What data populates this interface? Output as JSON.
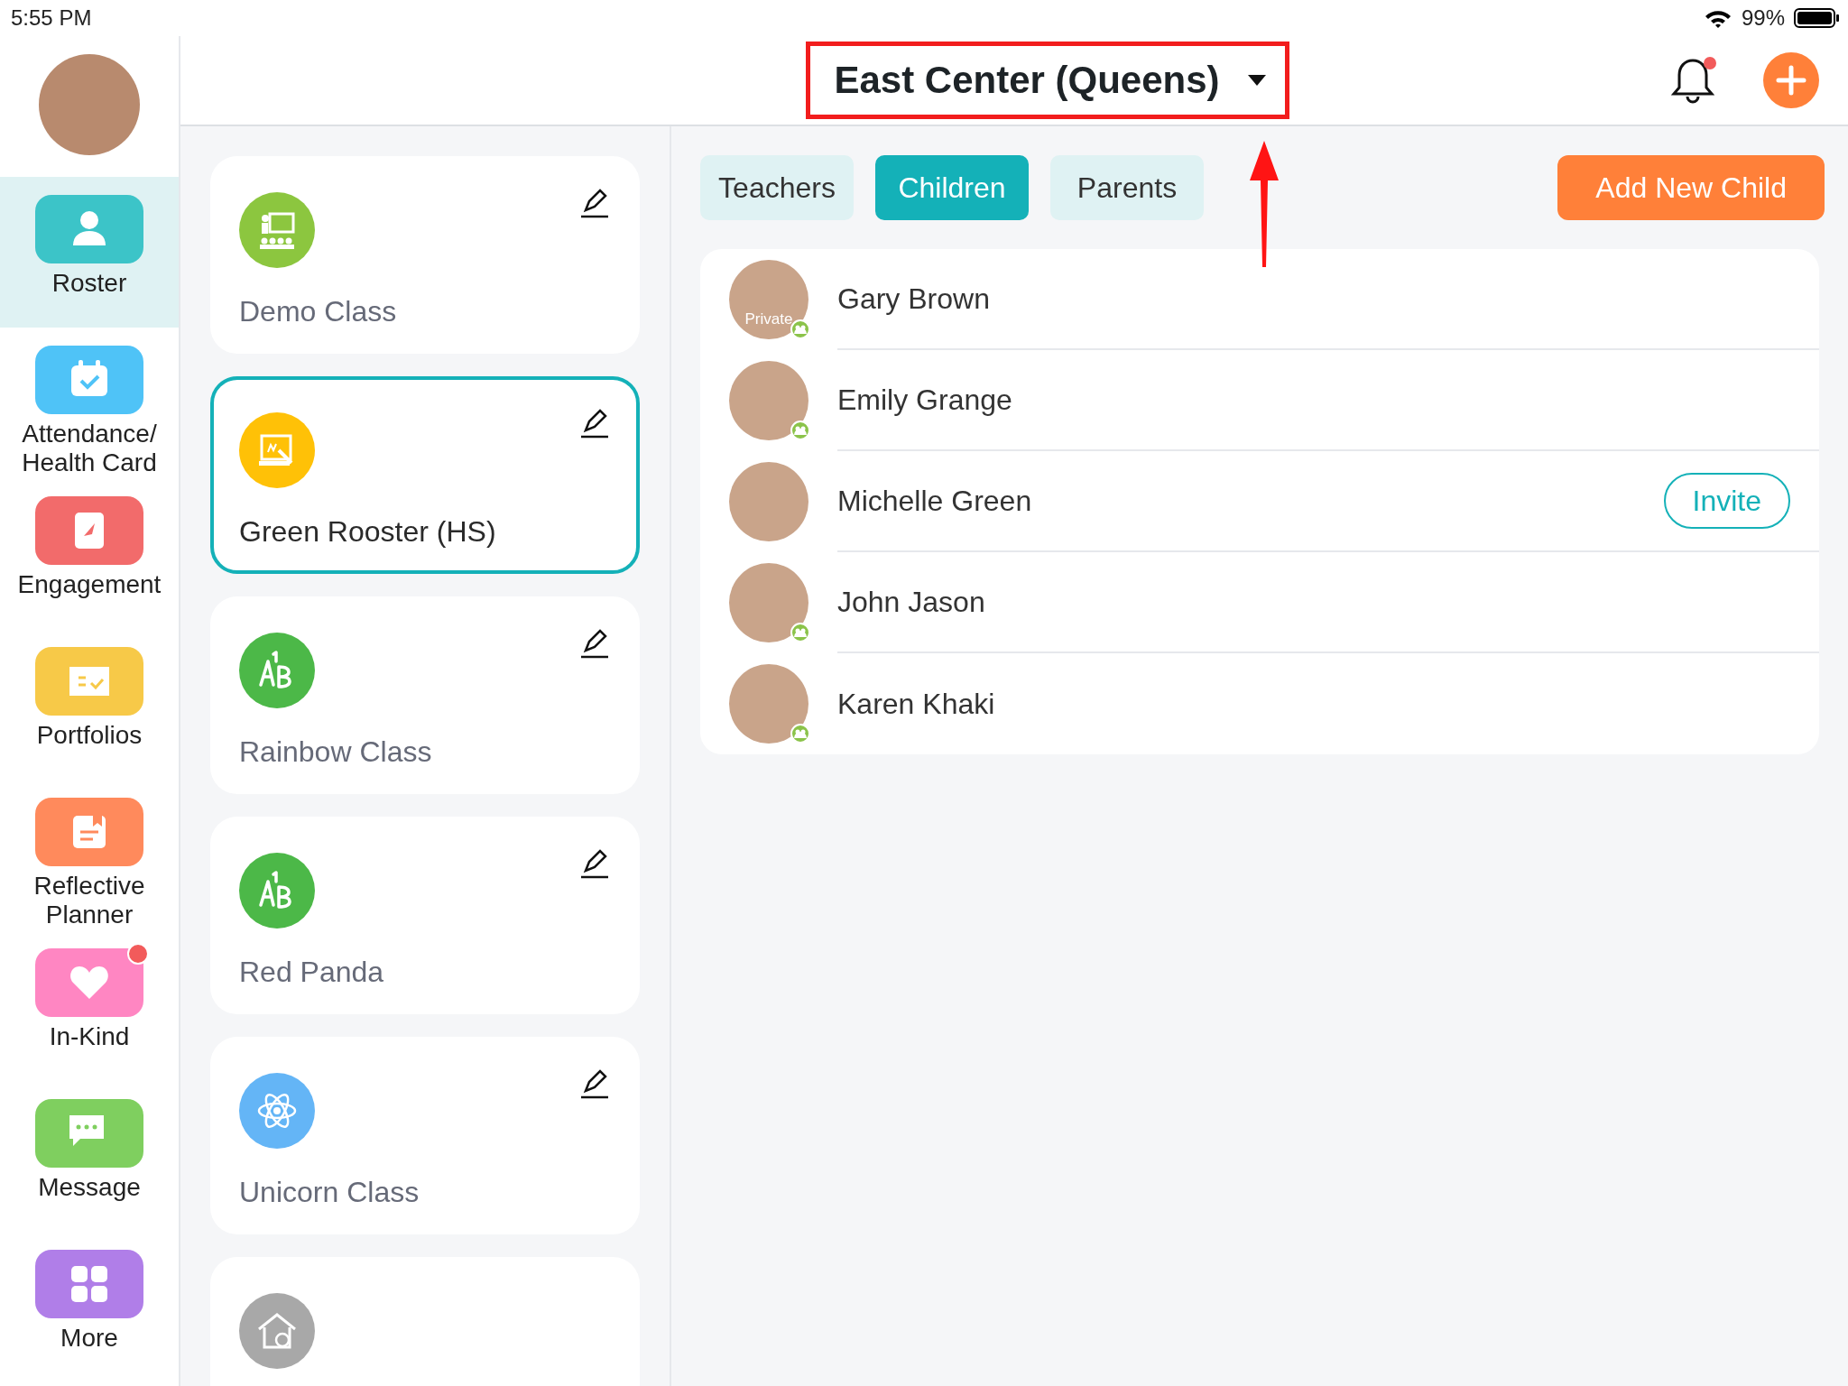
{
  "status_bar": {
    "time": "5:55 PM",
    "battery": "99%"
  },
  "sidebar": {
    "items": [
      {
        "label": "Roster",
        "selected": true,
        "kind": "person",
        "color": "#3cc4c8",
        "notification": false
      },
      {
        "label": "Attendance/ Health Card",
        "selected": false,
        "kind": "calendar",
        "color": "#4fc3f7",
        "notification": false
      },
      {
        "label": "Engagement",
        "selected": false,
        "kind": "note",
        "color": "#f26b6b",
        "notification": false
      },
      {
        "label": "Portfolios",
        "selected": false,
        "kind": "book",
        "color": "#f7c948",
        "notification": false
      },
      {
        "label": "Reflective Planner",
        "selected": false,
        "kind": "planner",
        "color": "#ff8a5c",
        "notification": false
      },
      {
        "label": "In-Kind",
        "selected": false,
        "kind": "heart",
        "color": "#ff86c2",
        "notification": true
      },
      {
        "label": "Message",
        "selected": false,
        "kind": "chat",
        "color": "#7fcf5f",
        "notification": false
      },
      {
        "label": "More",
        "selected": false,
        "kind": "grid",
        "color": "#b07ee8",
        "notification": false
      }
    ]
  },
  "header": {
    "center_selector": {
      "label": "East Center (Queens)",
      "highlighted": true
    },
    "notification": true
  },
  "classes": [
    {
      "name": "Demo Class",
      "selected": false,
      "kind": "teacher",
      "color": "#8cc63f"
    },
    {
      "name": "Green Rooster (HS)",
      "selected": true,
      "kind": "board",
      "color": "#ffc107"
    },
    {
      "name": "Rainbow Class",
      "selected": false,
      "kind": "letters",
      "color": "#4cb848"
    },
    {
      "name": "Red Panda",
      "selected": false,
      "kind": "letters",
      "color": "#4cb848"
    },
    {
      "name": "Unicorn Class",
      "selected": false,
      "kind": "atom",
      "color": "#64b5f6"
    },
    {
      "selected": false,
      "kind": "house",
      "color": "#a8a8a8"
    }
  ],
  "tabs": [
    {
      "label": "Teachers",
      "selected": false
    },
    {
      "label": "Children",
      "selected": true
    },
    {
      "label": "Parents",
      "selected": false
    }
  ],
  "add_button": "Add New Child",
  "children": [
    {
      "name": "Gary Brown",
      "avatar_label": "Private",
      "linked": true
    },
    {
      "name": "Emily Grange",
      "linked": true
    },
    {
      "name": "Michelle Green",
      "linked": false,
      "action": "Invite"
    },
    {
      "name": "John Jason",
      "linked": true
    },
    {
      "name": "Karen Khaki",
      "linked": true
    }
  ]
}
